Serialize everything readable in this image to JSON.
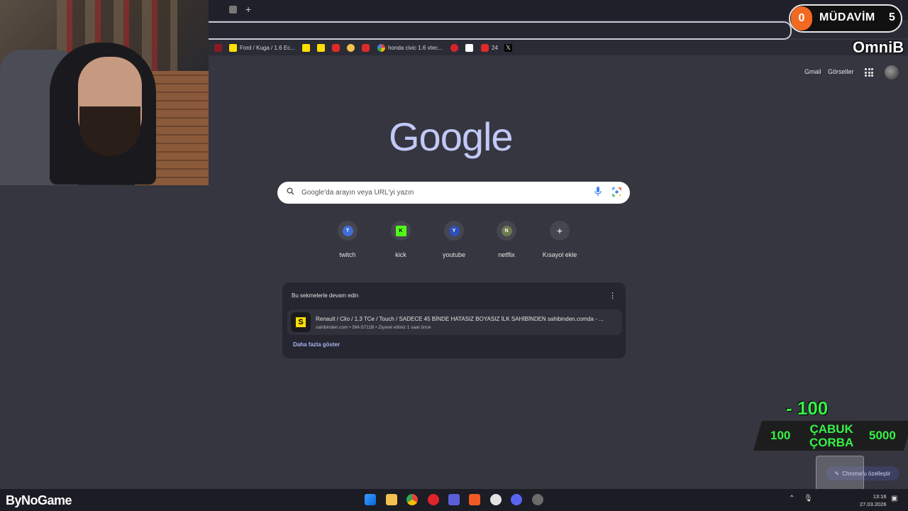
{
  "browser": {
    "new_tab_symbol": "+",
    "bookmarks": [
      {
        "label": "",
        "icon": "red-favicon"
      },
      {
        "label": "Ford / Kuga / 1.6 Ec...",
        "icon": "sahibinden-favicon"
      },
      {
        "label": "",
        "icon": "sahibinden-favicon"
      },
      {
        "label": "",
        "icon": "sahibinden-favicon"
      },
      {
        "label": "",
        "icon": "youtube-favicon"
      },
      {
        "label": "",
        "icon": "emoji-favicon"
      },
      {
        "label": "",
        "icon": "youtube-favicon"
      },
      {
        "label": "honda civic 1.6 vtec...",
        "icon": "google-favicon"
      },
      {
        "label": "",
        "icon": "red-favicon"
      },
      {
        "label": "",
        "icon": "amazon-favicon"
      },
      {
        "label": "24",
        "icon": "youtube-favicon"
      },
      {
        "label": "",
        "icon": "x-favicon"
      }
    ]
  },
  "overlay": {
    "mudavim_left": "0",
    "mudavim_label": "MÜDAVİM",
    "mudavim_count": "5",
    "omnib": "OmniB",
    "minus_value": "- 100",
    "corba_left": "100",
    "corba_title_line1": "ÇABUK",
    "corba_title_line2": "ÇORBA",
    "corba_right": "5000",
    "brand": "ByNoGame"
  },
  "google": {
    "gmail": "Gmail",
    "images": "Görseller",
    "logo": "Google",
    "search_placeholder": "Google'da arayın veya URL'yi yazın",
    "shortcuts": [
      {
        "label": "twitch",
        "initial": "T",
        "color": "#3f6fd8"
      },
      {
        "label": "kick",
        "initial": "K",
        "color": "#53fc18"
      },
      {
        "label": "youtube",
        "initial": "Y",
        "color": "#2f4fb8"
      },
      {
        "label": "netflix",
        "initial": "N",
        "color": "#6a7a4a"
      },
      {
        "label": "Kısayol ekle",
        "initial": "+",
        "color": ""
      }
    ],
    "continue_card": {
      "title": "Bu sekmelerle devam edin",
      "item_title": "Renault / Clio / 1.3 TCe / Touch / SADECE 45 BİNDE HATASIZ BOYASIZ İLK SAHİBİNDEN sahibinden.comda - ...",
      "item_meta": "sahibinden.com • SM-S711B • Ziyaret ettiniz 1 saat önce",
      "item_icon": "S",
      "show_more": "Daha fazla göster"
    },
    "customize": "Chrome'u özelleştir"
  },
  "taskbar": {
    "time": "13:16",
    "date": "27.03.2026"
  }
}
